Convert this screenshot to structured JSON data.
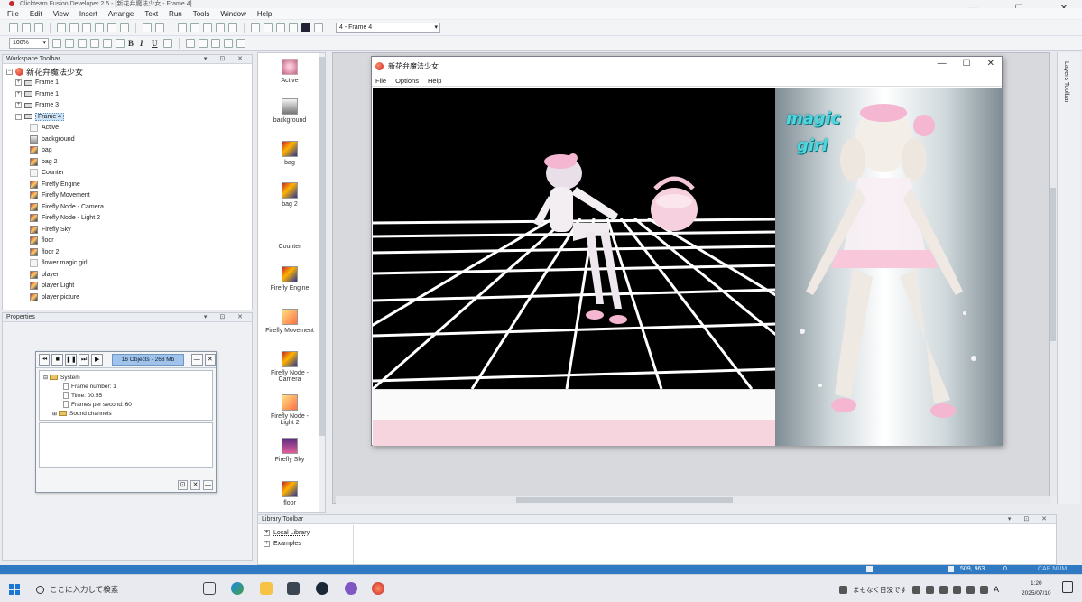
{
  "app": {
    "title": "Clickteam Fusion Developer 2.5 - [新花弁魔法少女 - Frame 4]",
    "window_controls": [
      "—",
      "☐",
      "✕"
    ]
  },
  "menubar": [
    "File",
    "Edit",
    "View",
    "Insert",
    "Arrange",
    "Text",
    "Run",
    "Tools",
    "Window",
    "Help"
  ],
  "toolbar": {
    "zoom": "100%",
    "frame_selector": "4 - Frame 4"
  },
  "workspace": {
    "title": "Workspace Toolbar",
    "app_name": "新花弁魔法少女",
    "frames": [
      "Frame 1",
      "Frame 1",
      "Frame 3",
      "Frame 4"
    ],
    "objects": [
      "Active",
      "background",
      "bag",
      "bag 2",
      "Counter",
      "Firefly Engine",
      "Firefly Movement",
      "Firefly Node - Camera",
      "Firefly Node - Light 2",
      "Firefly Sky",
      "floor",
      "floor 2",
      "flower magic girl",
      "player",
      "player Light",
      "player picture"
    ]
  },
  "properties": {
    "title": "Properties"
  },
  "debugger": {
    "status": "16 Objects - 268 Mb",
    "system_label": "System",
    "frame_number": "Frame number: 1",
    "time": "Time: 00:55",
    "fps": "Frames per second: 60",
    "sound": "Sound channels"
  },
  "shelf": [
    "Active",
    "background",
    "bag",
    "bag 2",
    "Counter",
    "Firefly Engine",
    "Firefly Movement",
    "Firefly Node - Camera",
    "Firefly Node - Light 2",
    "Firefly Sky",
    "floor"
  ],
  "game_window": {
    "title": "新花弁魔法少女",
    "menu": [
      "File",
      "Options",
      "Help"
    ],
    "caption_line1": "magic",
    "caption_line2": "girl"
  },
  "layers": {
    "title": "Layers Toolbar"
  },
  "library": {
    "title": "Library Toolbar",
    "items": [
      "Local Library",
      "Examples"
    ]
  },
  "statusbar": {
    "coords": "509, 963",
    "zero": "0",
    "capnum": "CAP NUM"
  },
  "taskbar": {
    "search_placeholder": "ここに入力して検索",
    "tray_text": "まもなく日没です",
    "ime": "A",
    "time": "1:20",
    "date": "2025/07/10"
  },
  "colors": {
    "statusbar": "#2f7ac2",
    "selection": "#cde3f7",
    "debugger_status": "#9fc3ea",
    "game_pink": "#f6d5df",
    "magic_text": "#4fd7e0"
  }
}
